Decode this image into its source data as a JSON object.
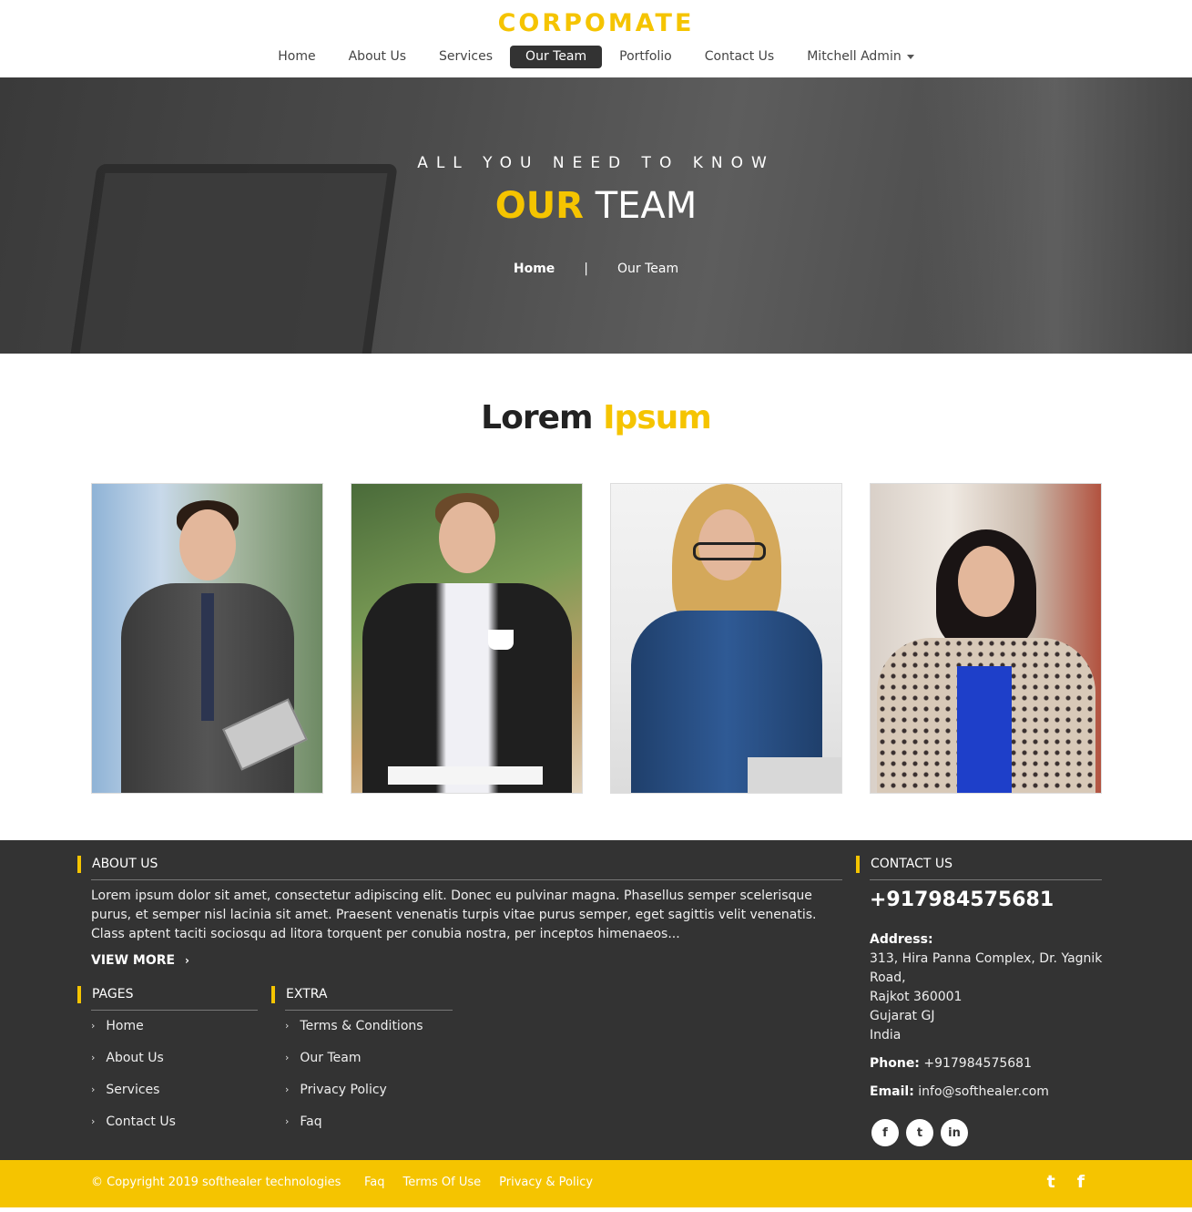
{
  "brand": {
    "logo": "CORPOMATE",
    "accent": "#f5c400",
    "dark": "#333333"
  },
  "nav": {
    "items": [
      "Home",
      "About Us",
      "Services",
      "Our Team",
      "Portfolio",
      "Contact Us"
    ],
    "active": "Our Team",
    "user": "Mitchell Admin"
  },
  "hero": {
    "eyebrow": "ALL YOU NEED TO KNOW",
    "title_highlight": "OUR",
    "title_rest": "TEAM",
    "breadcrumb": {
      "home": "Home",
      "separator": "|",
      "current": "Our Team"
    }
  },
  "team": {
    "title": "Lorem",
    "title_highlight": "Ipsum",
    "members": [
      {
        "photo": "man-with-tablet"
      },
      {
        "photo": "man-with-coffee"
      },
      {
        "photo": "woman-with-glasses"
      },
      {
        "photo": "woman-in-patterned-jacket"
      }
    ]
  },
  "footer": {
    "about": {
      "heading": "ABOUT US",
      "text": "Lorem ipsum dolor sit amet, consectetur adipiscing elit. Donec eu pulvinar magna. Phasellus semper scelerisque purus, et semper nisl lacinia sit amet. Praesent venenatis turpis vitae purus semper, eget sagittis velit venenatis. Class aptent taciti sociosqu ad litora torquent per conubia nostra, per inceptos himenaeos...",
      "view_more": "VIEW MORE"
    },
    "pages": {
      "heading": "PAGES",
      "items": [
        "Home",
        "About Us",
        "Services",
        "Contact Us"
      ]
    },
    "extra": {
      "heading": "EXTRA",
      "items": [
        "Terms & Conditions",
        "Our Team",
        "Privacy Policy",
        "Faq"
      ]
    },
    "contact": {
      "heading": "CONTACT US",
      "phone_big": "+917984575681",
      "address_label": "Address:",
      "address_lines": [
        "313, Hira Panna Complex, Dr. Yagnik",
        "Road,",
        "Rajkot 360001",
        "Gujarat GJ",
        "India"
      ],
      "phone_label": "Phone:",
      "phone": "+917984575681",
      "email_label": "Email:",
      "email": "info@softhealer.com",
      "social": [
        "facebook-icon",
        "twitter-icon",
        "linkedin-icon"
      ]
    }
  },
  "bottom_bar": {
    "copyright": "© Copyright 2019 softhealer technologies",
    "links": [
      "Faq",
      "Terms Of Use",
      "Privacy & Policy"
    ],
    "icons": [
      "twitter-icon",
      "facebook-icon"
    ]
  }
}
